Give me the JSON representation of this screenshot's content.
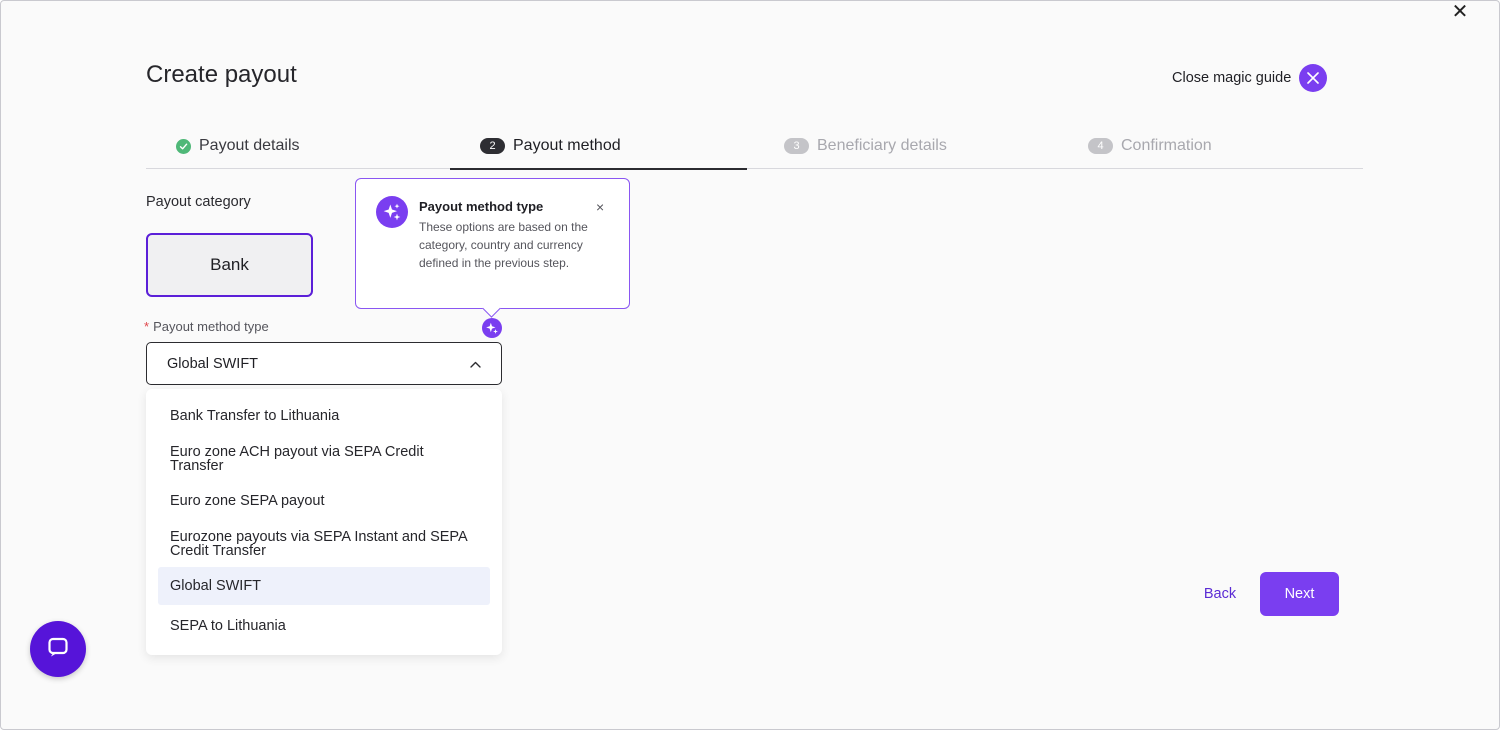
{
  "header": {
    "title": "Create payout",
    "close_magic_guide": "Close magic guide"
  },
  "steps": [
    {
      "label": "Payout details",
      "state": "done"
    },
    {
      "label": "Payout method",
      "number": "2",
      "state": "active"
    },
    {
      "label": "Beneficiary details",
      "number": "3",
      "state": "pending"
    },
    {
      "label": "Confirmation",
      "number": "4",
      "state": "pending"
    }
  ],
  "form": {
    "category_label": "Payout category",
    "category_option": "Bank",
    "method_label": "Payout method type",
    "required_mark": "*",
    "method_value": "Global SWIFT",
    "options": [
      "Bank Transfer to Lithuania",
      "Euro zone ACH payout via SEPA Credit Transfer",
      "Euro zone SEPA payout",
      "Eurozone payouts via SEPA Instant and SEPA Credit Transfer",
      "Global SWIFT",
      "SEPA to Lithuania"
    ],
    "selected_option": "Global SWIFT"
  },
  "popover": {
    "title": "Payout method type",
    "body": "These options are based on the category, country and currency defined in the previous step.",
    "close": "×"
  },
  "footer": {
    "back": "Back",
    "next": "Next"
  },
  "window_close": "✕",
  "colors": {
    "accent": "#7a3ef0",
    "accent_dark": "#5614d9",
    "success": "#4fb878",
    "selected_row": "#eef1fb"
  }
}
